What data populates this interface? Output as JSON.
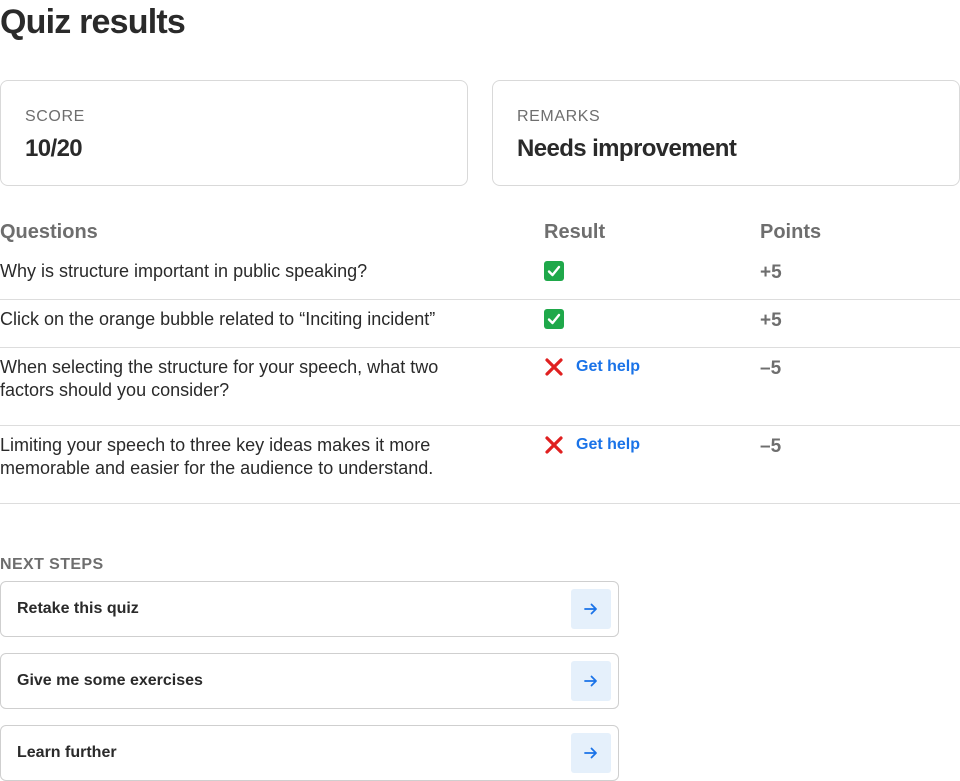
{
  "page": {
    "title": "Quiz results"
  },
  "summary": {
    "score_label": "SCORE",
    "score_value": "10/20",
    "remarks_label": "REMARKS",
    "remarks_value": "Needs improvement"
  },
  "questions": {
    "headers": {
      "question": "Questions",
      "result": "Result",
      "points": "Points"
    },
    "rows": [
      {
        "text": "Why is structure important in public speaking?",
        "result": "correct",
        "result_icon": "check-icon",
        "points": "+5"
      },
      {
        "text": "Click on the orange bubble related to “Inciting incident”",
        "result": "correct",
        "result_icon": "check-icon",
        "points": "+5"
      },
      {
        "text": "When selecting the structure for your speech, what two factors should you consider?",
        "result": "incorrect",
        "result_icon": "cross-icon",
        "help_label": "Get help",
        "points": "–5"
      },
      {
        "text": "Limiting your speech to three key ideas makes it more memorable and easier for the audience to understand.",
        "result": "incorrect",
        "result_icon": "cross-icon",
        "help_label": "Get help",
        "points": "–5"
      }
    ]
  },
  "next_steps": {
    "title": "NEXT STEPS",
    "items": [
      {
        "label": "Retake this quiz",
        "icon": "arrow-right-icon"
      },
      {
        "label": "Give me some exercises",
        "icon": "arrow-right-icon"
      },
      {
        "label": "Learn further",
        "icon": "arrow-right-icon"
      }
    ]
  },
  "colors": {
    "correct": "#1fa84a",
    "incorrect": "#e02020",
    "link": "#1a73e8",
    "arrow_button_bg": "#e5f0fb"
  }
}
